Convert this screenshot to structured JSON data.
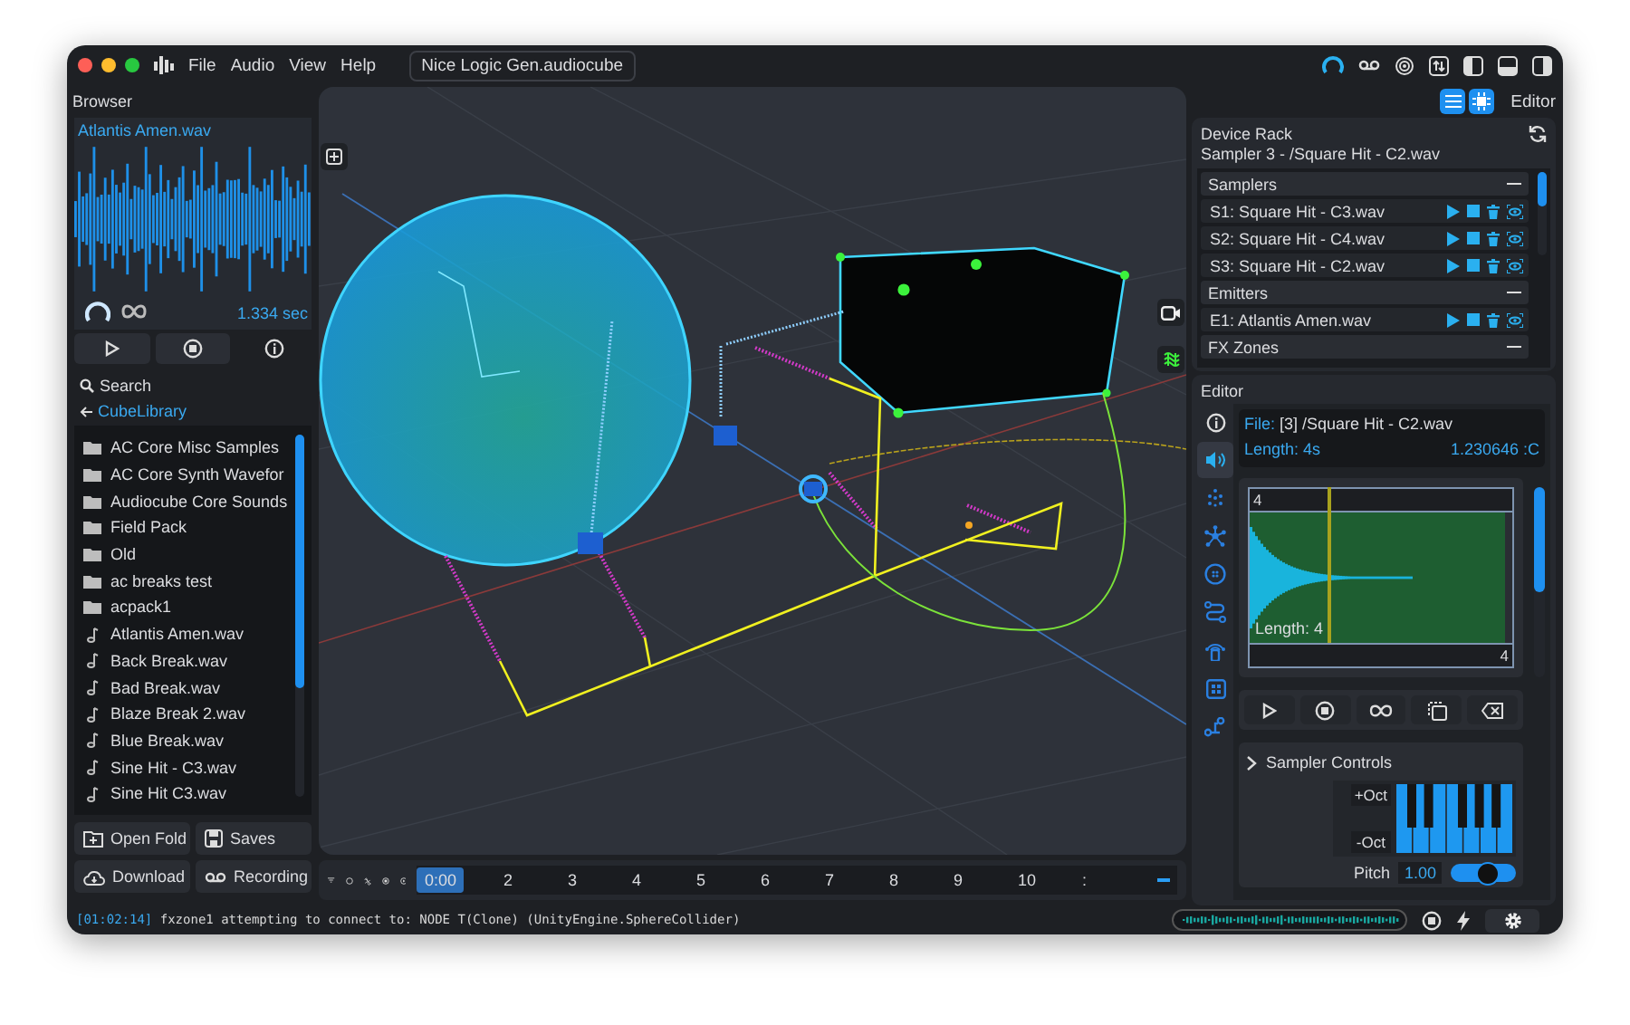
{
  "window": {
    "title": "Nice Logic Gen.audiocube"
  },
  "menu": [
    {
      "label": "File"
    },
    {
      "label": "Audio"
    },
    {
      "label": "View"
    },
    {
      "label": "Help"
    }
  ],
  "toolbar": {
    "buttons": [
      {
        "kind": "list",
        "on": true
      },
      {
        "kind": "chip",
        "on": true
      }
    ],
    "mode": "Editor"
  },
  "browser": {
    "title": "Browser",
    "preview": {
      "file": "Atlantis Amen.wav",
      "duration": "1.334 sec"
    },
    "search": "Search",
    "path": "CubeLibrary",
    "items": [
      {
        "kind": "folder",
        "name": "AC Core Misc Samples"
      },
      {
        "kind": "folder",
        "name": "AC Core Synth Wavefor"
      },
      {
        "kind": "folder",
        "name": "Audiocube Core Sounds"
      },
      {
        "kind": "folder",
        "name": "Field Pack"
      },
      {
        "kind": "folder",
        "name": "Old"
      },
      {
        "kind": "folder",
        "name": "ac breaks test"
      },
      {
        "kind": "folder",
        "name": "acpack1"
      },
      {
        "kind": "file",
        "name": "Atlantis Amen.wav"
      },
      {
        "kind": "file",
        "name": "Back Break.wav"
      },
      {
        "kind": "file",
        "name": "Bad Break.wav"
      },
      {
        "kind": "file",
        "name": "Blaze Break 2.wav"
      },
      {
        "kind": "file",
        "name": "Blue Break.wav"
      },
      {
        "kind": "file",
        "name": "Sine Hit - C3.wav"
      },
      {
        "kind": "file",
        "name": "Sine Hit C3.wav"
      }
    ],
    "actions": [
      {
        "kind": "folder",
        "label": "Open Fold"
      },
      {
        "kind": "save",
        "label": "Saves"
      },
      {
        "kind": "download",
        "label": "Download"
      },
      {
        "kind": "record",
        "label": "Recording"
      }
    ]
  },
  "timeline": {
    "playhead": "0:00",
    "ticks": [
      "2",
      "3",
      "4",
      "5",
      "6",
      "7",
      "8",
      "9",
      "10",
      ":"
    ]
  },
  "device_rack": {
    "title": "Device Rack",
    "subtitle": "Sampler 3 - /Square Hit - C2.wav",
    "groups": [
      {
        "name": "Samplers",
        "items": [
          "S1: Square Hit - C3.wav",
          "S2: Square Hit - C4.wav",
          "S3: Square Hit - C2.wav"
        ]
      },
      {
        "name": "Emitters",
        "items": [
          "E1: Atlantis Amen.wav"
        ]
      },
      {
        "name": "FX Zones"
      }
    ]
  },
  "editor": {
    "title": "Editor",
    "tabs": [
      {
        "kind": "info",
        "selected": false
      },
      {
        "kind": "speaker",
        "selected": true
      },
      {
        "kind": "dots",
        "selected": false
      },
      {
        "kind": "network",
        "selected": false
      },
      {
        "kind": "globe",
        "selected": false
      },
      {
        "kind": "route",
        "selected": false
      },
      {
        "kind": "antenna",
        "selected": false
      },
      {
        "kind": "grid",
        "selected": false
      },
      {
        "kind": "nodes",
        "selected": false
      }
    ],
    "file_label": "File:",
    "file": "[3] /Square Hit - C2.wav",
    "length": "Length: 4s",
    "position": "1.230646 :C",
    "sample": {
      "start": "4",
      "length": "Length: 4",
      "end": "4"
    },
    "controls_title": "Sampler Controls",
    "oct_up": "+Oct",
    "oct_down": "-Oct",
    "pitch_label": "Pitch",
    "pitch": "1.00",
    "pitch_toggle": {
      "on": true
    }
  },
  "status": {
    "time": "[01:02:14]",
    "message": "fxzone1 attempting to connect to: NODE T(Clone) (UnityEngine.SphereCollider)"
  }
}
